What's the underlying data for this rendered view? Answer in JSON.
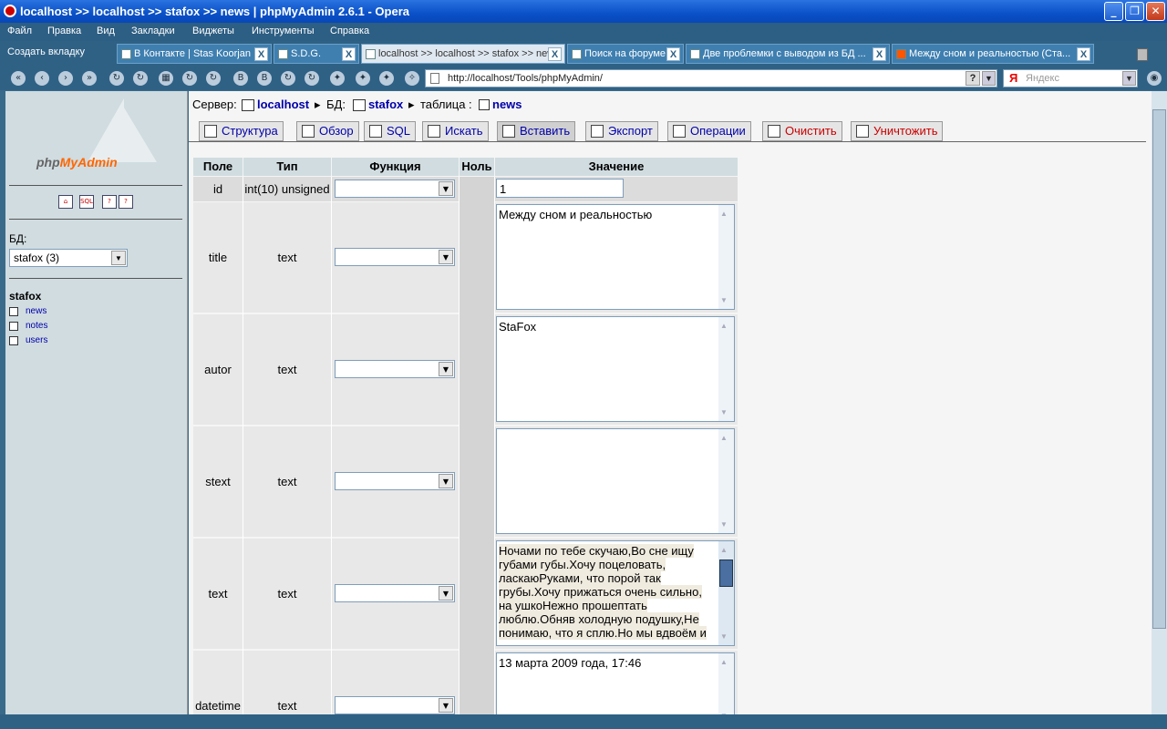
{
  "window": {
    "title": "localhost >> localhost >> stafox  >> news | phpMyAdmin 2.6.1 - Opera"
  },
  "menu": [
    "Файл",
    "Правка",
    "Вид",
    "Закладки",
    "Виджеты",
    "Инструменты",
    "Справка"
  ],
  "tabs": {
    "new_tab": "Создать вкладку",
    "items": [
      {
        "label": "В Контакте | Stas Koorjan"
      },
      {
        "label": "S.D.G."
      },
      {
        "label": "localhost >> localhost >> stafox  >> news"
      },
      {
        "label": "Поиск на форуме"
      },
      {
        "label": "Две проблемки с выводом из БД ..."
      },
      {
        "label": "Между сном и реальностью (Ста..."
      }
    ]
  },
  "address": {
    "url": "http://localhost/Tools/phpMyAdmin/",
    "search_placeholder": "Яндекс"
  },
  "left": {
    "logo": "phpMyAdmin",
    "db_label": "БД:",
    "db_select": "stafox (3)",
    "db_name": "stafox",
    "tables": [
      "news",
      "notes",
      "users"
    ]
  },
  "breadcrumb": {
    "server_label": "Сервер:",
    "server": "localhost",
    "db_label": "БД:",
    "db": "stafox",
    "table_label": "таблица :",
    "table": "news"
  },
  "toolbar": [
    "Структура",
    "Обзор",
    "SQL",
    "Искать",
    "Вставить",
    "Экспорт",
    "Операции",
    "Очистить",
    "Уничтожить"
  ],
  "form": {
    "headers": [
      "Поле",
      "Тип",
      "Функция",
      "Ноль",
      "Значение"
    ],
    "rows": [
      {
        "field": "id",
        "type": "int(10) unsigned",
        "value": "1"
      },
      {
        "field": "title",
        "type": "text",
        "value": "Между сном и реальностью"
      },
      {
        "field": "autor",
        "type": "text",
        "value": "StaFox"
      },
      {
        "field": "stext",
        "type": "text",
        "value": ""
      },
      {
        "field": "text",
        "type": "text",
        "value_lines": [
          "Ночами по тебе скучаю,Во сне ищу",
          "губами губы.Хочу поцеловать,",
          "ласкаюРуками, что порой так",
          "грубы.Хочу прижаться очень сильно,",
          "на ушкоНежно прошептать",
          "люблю.Обняв холодную подушку,Не",
          "понимаю, что я сплю.Но мы вдвоём и"
        ]
      },
      {
        "field": "datetime",
        "type": "text",
        "value": "13 марта 2009 года, 17:46"
      }
    ]
  }
}
